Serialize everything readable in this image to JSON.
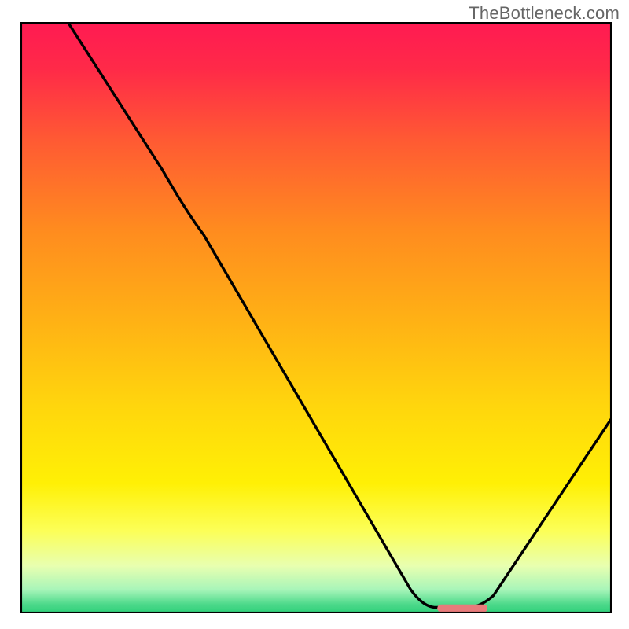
{
  "watermark": "TheBottleneck.com",
  "chart_data": {
    "type": "line",
    "title": "",
    "xlabel": "",
    "ylabel": "",
    "xlim": [
      0,
      100
    ],
    "ylim": [
      0,
      100
    ],
    "background_gradient": {
      "stops": [
        {
          "offset": 0.0,
          "color": "#ff1a52"
        },
        {
          "offset": 0.08,
          "color": "#ff2a48"
        },
        {
          "offset": 0.2,
          "color": "#ff5a33"
        },
        {
          "offset": 0.35,
          "color": "#ff8b1f"
        },
        {
          "offset": 0.5,
          "color": "#ffb015"
        },
        {
          "offset": 0.65,
          "color": "#ffd60d"
        },
        {
          "offset": 0.78,
          "color": "#fff005"
        },
        {
          "offset": 0.86,
          "color": "#fcff57"
        },
        {
          "offset": 0.92,
          "color": "#e8ffb0"
        },
        {
          "offset": 0.96,
          "color": "#a8f5b9"
        },
        {
          "offset": 0.985,
          "color": "#4cd98a"
        },
        {
          "offset": 1.0,
          "color": "#2ecf7a"
        }
      ]
    },
    "series": [
      {
        "name": "bottleneck-curve",
        "type": "line",
        "color": "#000000",
        "points": [
          {
            "x": 8,
            "y": 100
          },
          {
            "x": 24,
            "y": 75
          },
          {
            "x": 31,
            "y": 64
          },
          {
            "x": 66,
            "y": 4
          },
          {
            "x": 70,
            "y": 1
          },
          {
            "x": 76,
            "y": 1
          },
          {
            "x": 80,
            "y": 3
          },
          {
            "x": 100,
            "y": 33
          }
        ]
      }
    ],
    "marker": {
      "name": "optimal-range-marker",
      "color": "#e87b7b",
      "x_start": 71,
      "x_end": 79,
      "y": 0.8,
      "thickness": 1.2
    }
  }
}
